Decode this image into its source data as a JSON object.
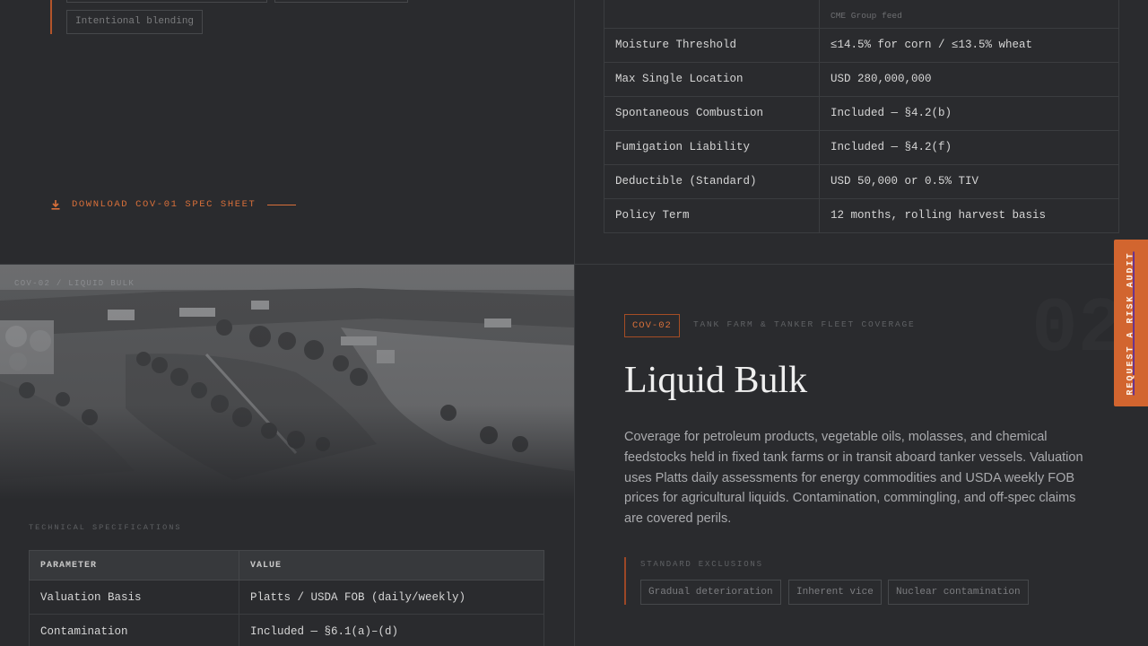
{
  "top_left": {
    "blending_chip": "Intentional blending",
    "download_label": "DOWNLOAD COV-01 SPEC SHEET"
  },
  "spec_table_1": {
    "source_note": "CME Group feed",
    "rows": [
      {
        "parameter": "Moisture Threshold",
        "value": "≤14.5% for corn / ≤13.5% wheat"
      },
      {
        "parameter": "Max Single Location",
        "value": "USD 280,000,000"
      },
      {
        "parameter": "Spontaneous Combustion",
        "value": "Included — §4.2(b)"
      },
      {
        "parameter": "Fumigation Liability",
        "value": "Included — §4.2(f)"
      },
      {
        "parameter": "Deductible (Standard)",
        "value": "USD 50,000 or 0.5% TIV"
      },
      {
        "parameter": "Policy Term",
        "value": "12 months, rolling harvest basis"
      }
    ]
  },
  "photo": {
    "label": "COV-02 / LIQUID BULK"
  },
  "tech_specs": {
    "label": "TECHNICAL SPECIFICATIONS",
    "header_parameter": "PARAMETER",
    "header_value": "VALUE",
    "rows": [
      {
        "parameter": "Valuation Basis",
        "value": "Platts / USDA FOB (daily/weekly)"
      },
      {
        "parameter": "Contamination",
        "value": "Included — §6.1(a)–(d)"
      }
    ]
  },
  "liquid_bulk": {
    "watermark": "02",
    "badge": "COV-02",
    "kicker": "TANK FARM & TANKER FLEET COVERAGE",
    "title": "Liquid Bulk",
    "body": "Coverage for petroleum products, vegetable oils, molasses, and chemical feedstocks held in fixed tank farms or in transit aboard tanker vessels. Valuation uses Platts daily assessments for energy commodities and USDA weekly FOB prices for agricultural liquids. Contamination, commingling, and off-spec claims are covered perils.",
    "exclusions_label": "STANDARD EXCLUSIONS",
    "exclusions": [
      "Gradual deterioration",
      "Inherent vice",
      "Nuclear contamination"
    ]
  },
  "risk_audit_tab": "REQUEST A RISK AUDIT",
  "colors": {
    "accent": "#d9703a",
    "background": "#2a2b2e"
  }
}
